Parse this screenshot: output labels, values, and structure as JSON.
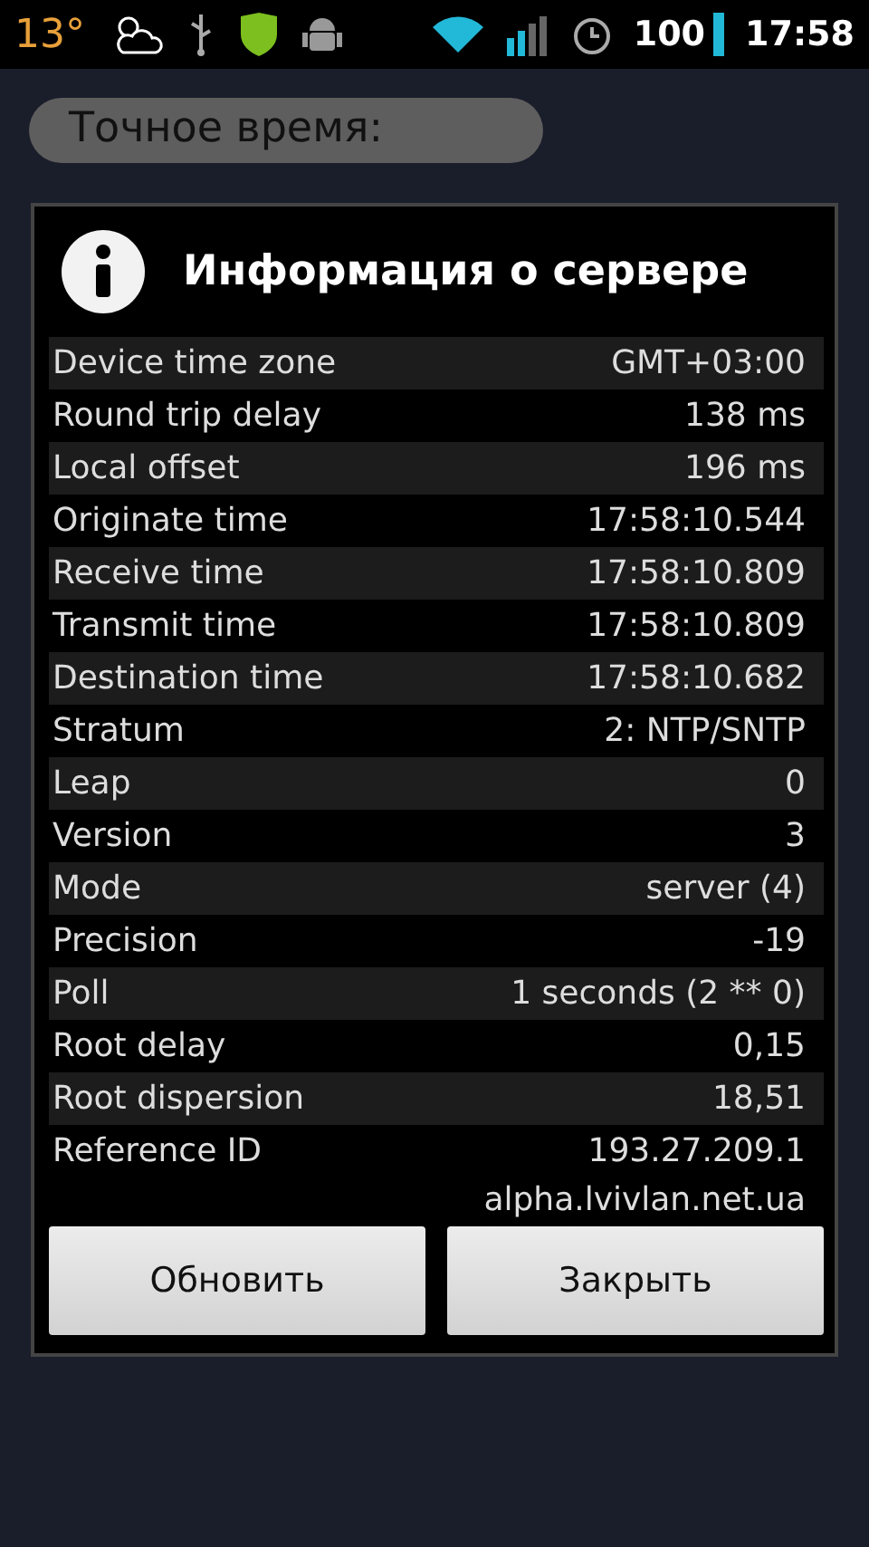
{
  "status_bar": {
    "temperature": "13°",
    "battery": "100",
    "time": "17:58"
  },
  "background": {
    "label": "Точное время:"
  },
  "dialog": {
    "title": "Информация о сервере",
    "rows": [
      {
        "label": "Device time zone",
        "value": "GMT+03:00"
      },
      {
        "label": "Round trip delay",
        "value": "138 ms"
      },
      {
        "label": "Local offset",
        "value": "196 ms"
      },
      {
        "label": "Originate time",
        "value": "17:58:10.544"
      },
      {
        "label": "Receive time",
        "value": "17:58:10.809"
      },
      {
        "label": "Transmit time",
        "value": "17:58:10.809"
      },
      {
        "label": "Destination time",
        "value": "17:58:10.682"
      },
      {
        "label": "Stratum",
        "value": "2: NTP/SNTP"
      },
      {
        "label": "Leap",
        "value": "0"
      },
      {
        "label": "Version",
        "value": "3"
      },
      {
        "label": "Mode",
        "value": "server (4)"
      },
      {
        "label": "Precision",
        "value": "-19"
      },
      {
        "label": "Poll",
        "value": "1 seconds (2 ** 0)"
      },
      {
        "label": "Root delay",
        "value": "0,15"
      },
      {
        "label": "Root dispersion",
        "value": "18,51"
      },
      {
        "label": "Reference ID",
        "value": "193.27.209.1"
      }
    ],
    "host": "alpha.lvivlan.net.ua",
    "buttons": [
      "Обновить",
      "Закрыть"
    ]
  }
}
